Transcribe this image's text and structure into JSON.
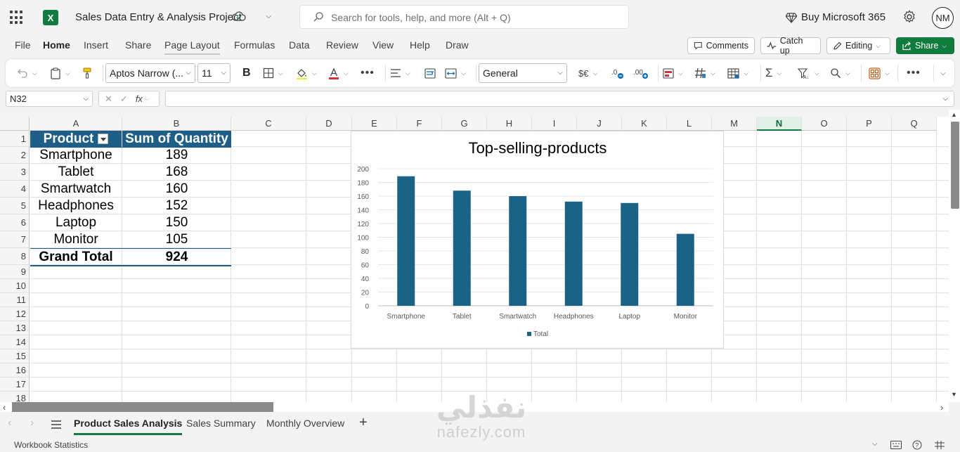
{
  "app": {
    "logo_letter": "X",
    "document_title": "Sales Data Entry & Analysis Project",
    "search_placeholder": "Search for tools, help, and more (Alt + Q)",
    "buy_label": "Buy Microsoft 365",
    "avatar_initials": "NM",
    "accent_color": "#107c41"
  },
  "ribbon_tabs": [
    "File",
    "Home",
    "Insert",
    "Share",
    "Page Layout",
    "Formulas",
    "Data",
    "Review",
    "View",
    "Help",
    "Draw"
  ],
  "ribbon_actions": {
    "comments": "Comments",
    "catch_up": "Catch up",
    "editing": "Editing",
    "share": "Share"
  },
  "toolbar": {
    "font_name": "Aptos Narrow (...",
    "font_size": "11",
    "bold": "B",
    "number_format": "General",
    "currency": "$€"
  },
  "formula_bar": {
    "name_box": "N32",
    "fx": "fx",
    "formula": ""
  },
  "grid": {
    "columns": [
      "A",
      "B",
      "C",
      "D",
      "E",
      "F",
      "G",
      "H",
      "I",
      "J",
      "K",
      "L",
      "M",
      "N",
      "O",
      "P",
      "Q"
    ],
    "selected_column": "N",
    "rows": [
      "1",
      "2",
      "3",
      "4",
      "5",
      "6",
      "7",
      "8",
      "9",
      "10",
      "11",
      "12",
      "13",
      "14",
      "15",
      "16",
      "17",
      "18"
    ]
  },
  "pivot": {
    "header_product": "Product",
    "header_quantity": "Sum of Quantity",
    "rows": [
      {
        "product": "Smartphone",
        "quantity": "189"
      },
      {
        "product": "Tablet",
        "quantity": "168"
      },
      {
        "product": "Smartwatch",
        "quantity": "160"
      },
      {
        "product": "Headphones",
        "quantity": "152"
      },
      {
        "product": "Laptop",
        "quantity": "150"
      },
      {
        "product": "Monitor",
        "quantity": "105"
      }
    ],
    "total_label": "Grand Total",
    "total_value": "924",
    "header_color": "#1f5e86"
  },
  "chart_data": {
    "type": "bar",
    "title": "Top-selling-products",
    "categories": [
      "Smartphone",
      "Tablet",
      "Smartwatch",
      "Headphones",
      "Laptop",
      "Monitor"
    ],
    "series": [
      {
        "name": "Total",
        "values": [
          189,
          168,
          160,
          152,
          150,
          105
        ]
      }
    ],
    "ylim": [
      0,
      200
    ],
    "yticks": [
      "0",
      "20",
      "40",
      "60",
      "80",
      "100",
      "120",
      "140",
      "160",
      "180",
      "200"
    ],
    "xlabel": "",
    "ylabel": "",
    "legend": "bottom",
    "grid": true,
    "bar_color": "#1b6384"
  },
  "sheet_tabs": [
    "Product Sales Analysis",
    "Sales Summary",
    "Monthly Overview"
  ],
  "active_sheet": "Product Sales Analysis",
  "status": {
    "left": "Workbook Statistics"
  },
  "watermark": {
    "arabic": "نفذلي",
    "latin": "nafezly.com"
  }
}
